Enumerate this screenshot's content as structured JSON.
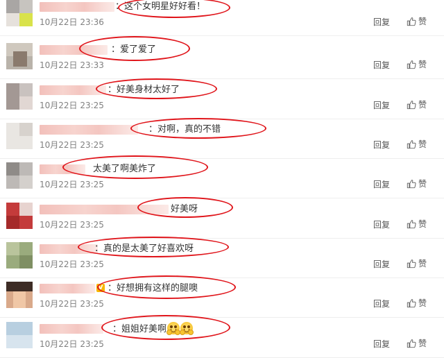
{
  "comments": [
    {
      "text": "：这个女明星好好看！",
      "timestamp": "10月22日 23:36"
    },
    {
      "text": "：爱了爱了",
      "timestamp": "10月22日 23:33"
    },
    {
      "text": "：好美身材太好了",
      "timestamp": "10月22日 23:25"
    },
    {
      "text": "：对啊，真的不错",
      "timestamp": "10月22日 23:25"
    },
    {
      "text": "太美了啊美炸了",
      "timestamp": "10月22日 23:25"
    },
    {
      "text": "好美呀",
      "timestamp": "10月22日 23:25"
    },
    {
      "text": "：真的是太美了好喜欢呀",
      "timestamp": "10月22日 23:25"
    },
    {
      "text": "：好想拥有这样的腿噢",
      "timestamp": "10月22日 23:25"
    },
    {
      "text": "：姐姐好美啊",
      "timestamp": "10月22日 23:25",
      "emoji": "hug-emoji"
    }
  ],
  "actions": {
    "reply_label": "回复",
    "like_label": "赞"
  },
  "colors": {
    "annotation_red": "#e0141a",
    "name_blur": "#f3c0ba"
  }
}
